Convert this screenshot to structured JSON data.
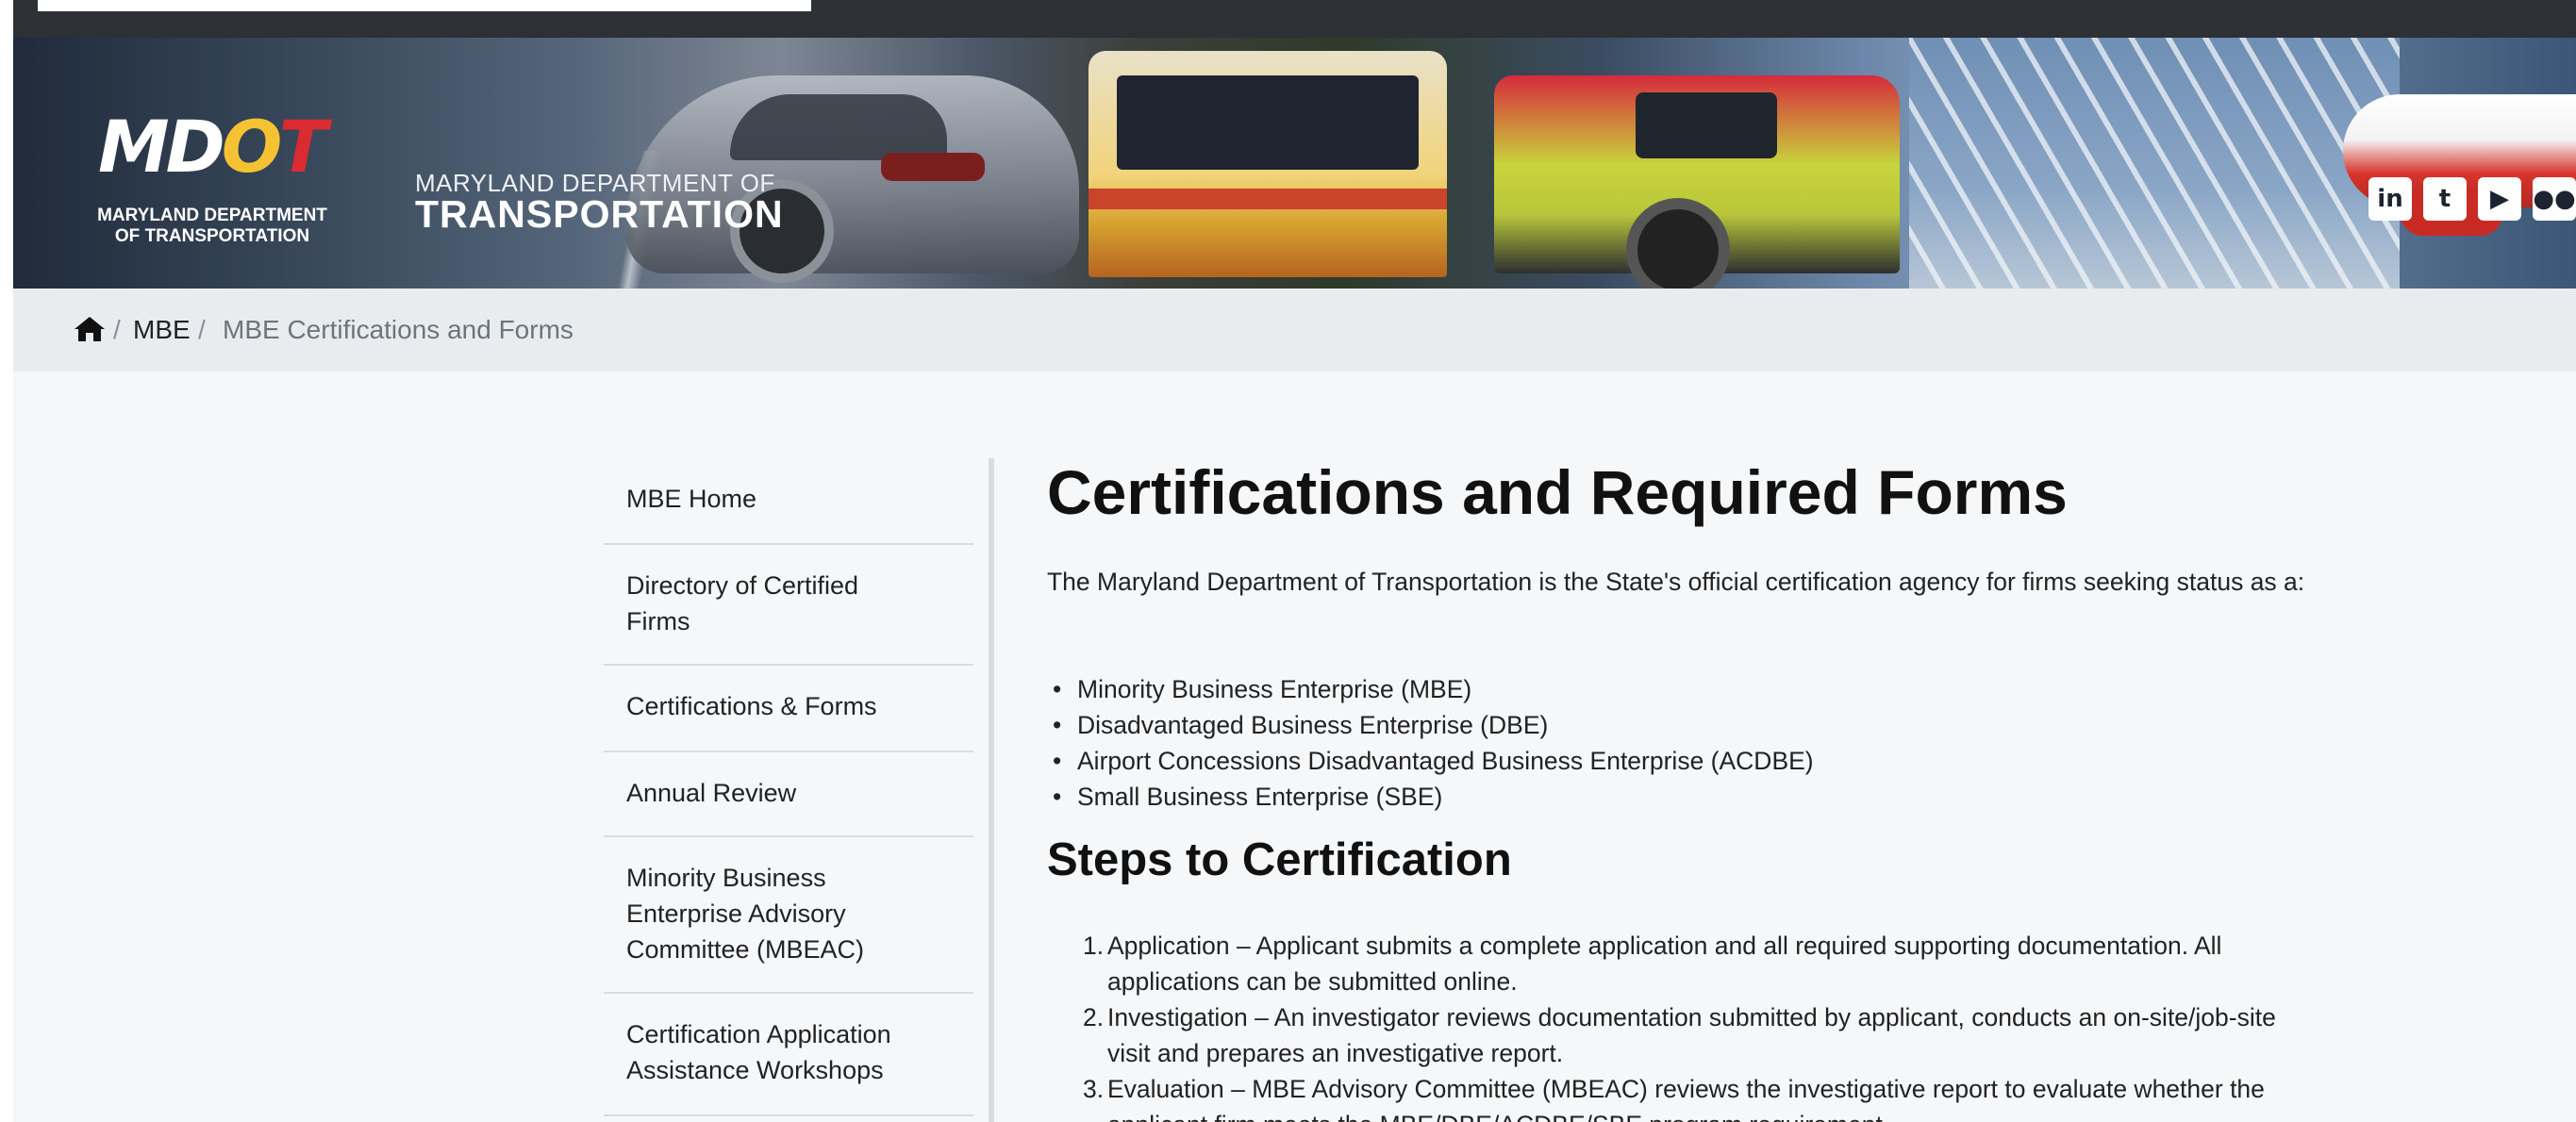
{
  "banner": {
    "logo_mark": [
      "M",
      "D",
      "O",
      "T"
    ],
    "logo_line1": "MARYLAND DEPARTMENT",
    "logo_line2": "OF TRANSPORTATION",
    "dept_small": "MARYLAND DEPARTMENT OF",
    "dept_big": "TRANSPORTATION",
    "social_icons": [
      "linkedin-icon",
      "twitter-icon",
      "youtube-icon",
      "flickr-icon"
    ],
    "social_glyphs": [
      "in",
      "t",
      "▶",
      "●●"
    ]
  },
  "breadcrumb": {
    "home_icon": "home-icon",
    "separator": "/",
    "items": [
      "MBE",
      "MBE Certifications and Forms"
    ]
  },
  "sidebar": {
    "items": [
      {
        "label": "MBE Home"
      },
      {
        "label": "Directory of Certified Firms"
      },
      {
        "label": "Certifications & Forms"
      },
      {
        "label": "Annual Review"
      },
      {
        "label": "Minority Business Enterprise Advisory Committee (MBEAC)"
      },
      {
        "label": "Certification Application Assistance Workshops"
      }
    ]
  },
  "main": {
    "title": "Certifications and Required Forms",
    "intro": "The Maryland Department of Transportation is the State's official certification agency for firms seeking status as a:",
    "statuses": [
      "Minority Business Enterprise (MBE)",
      "Disadvantaged Business Enterprise (DBE)",
      "Airport Concessions Disadvantaged Business Enterprise (ACDBE)",
      "Small Business Enterprise (SBE)"
    ],
    "steps_heading": "Steps to Certification",
    "steps": [
      {
        "num": "1.",
        "text": "Application – Applicant submits a complete application and all required supporting documentation. All applications can be submitted online."
      },
      {
        "num": "2.",
        "text": "Investigation – An investigator reviews documentation submitted by applicant, conducts an on-site/job-site visit and prepares an investigative report."
      },
      {
        "num": "3.",
        "text": "Evaluation – MBE Advisory Committee (MBEAC) reviews the investigative report to evaluate whether the applicant firm meets the MBE/DBE/ACDBE/SBE program requirement."
      }
    ]
  },
  "colors": {
    "page_bg": "#f6f7f9",
    "breadcrumb_bg": "#e9ecef",
    "logo_gold": "#f5c233",
    "logo_red": "#d92b30"
  }
}
